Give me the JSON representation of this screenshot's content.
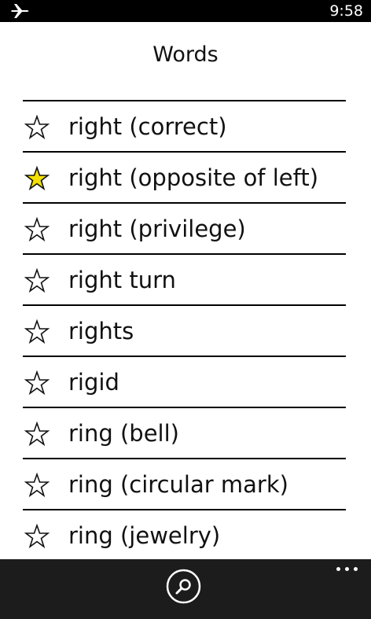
{
  "status_bar": {
    "airplane_icon": "airplane-icon",
    "time": "9:58"
  },
  "page": {
    "title": "Words"
  },
  "words": [
    {
      "label": "right (correct)",
      "favorite": false
    },
    {
      "label": "right (opposite of left)",
      "favorite": true
    },
    {
      "label": "right (privilege)",
      "favorite": false
    },
    {
      "label": "right turn",
      "favorite": false
    },
    {
      "label": "rights",
      "favorite": false
    },
    {
      "label": "rigid",
      "favorite": false
    },
    {
      "label": "ring (bell)",
      "favorite": false
    },
    {
      "label": "ring (circular mark)",
      "favorite": false
    },
    {
      "label": "ring (jewelry)",
      "favorite": false
    }
  ],
  "app_bar": {
    "search_icon": "search-icon",
    "more_icon": "more-icon"
  },
  "colors": {
    "favorite_fill": "#f5e100",
    "app_bar": "#1c1c1c",
    "status_bar": "#000000"
  }
}
